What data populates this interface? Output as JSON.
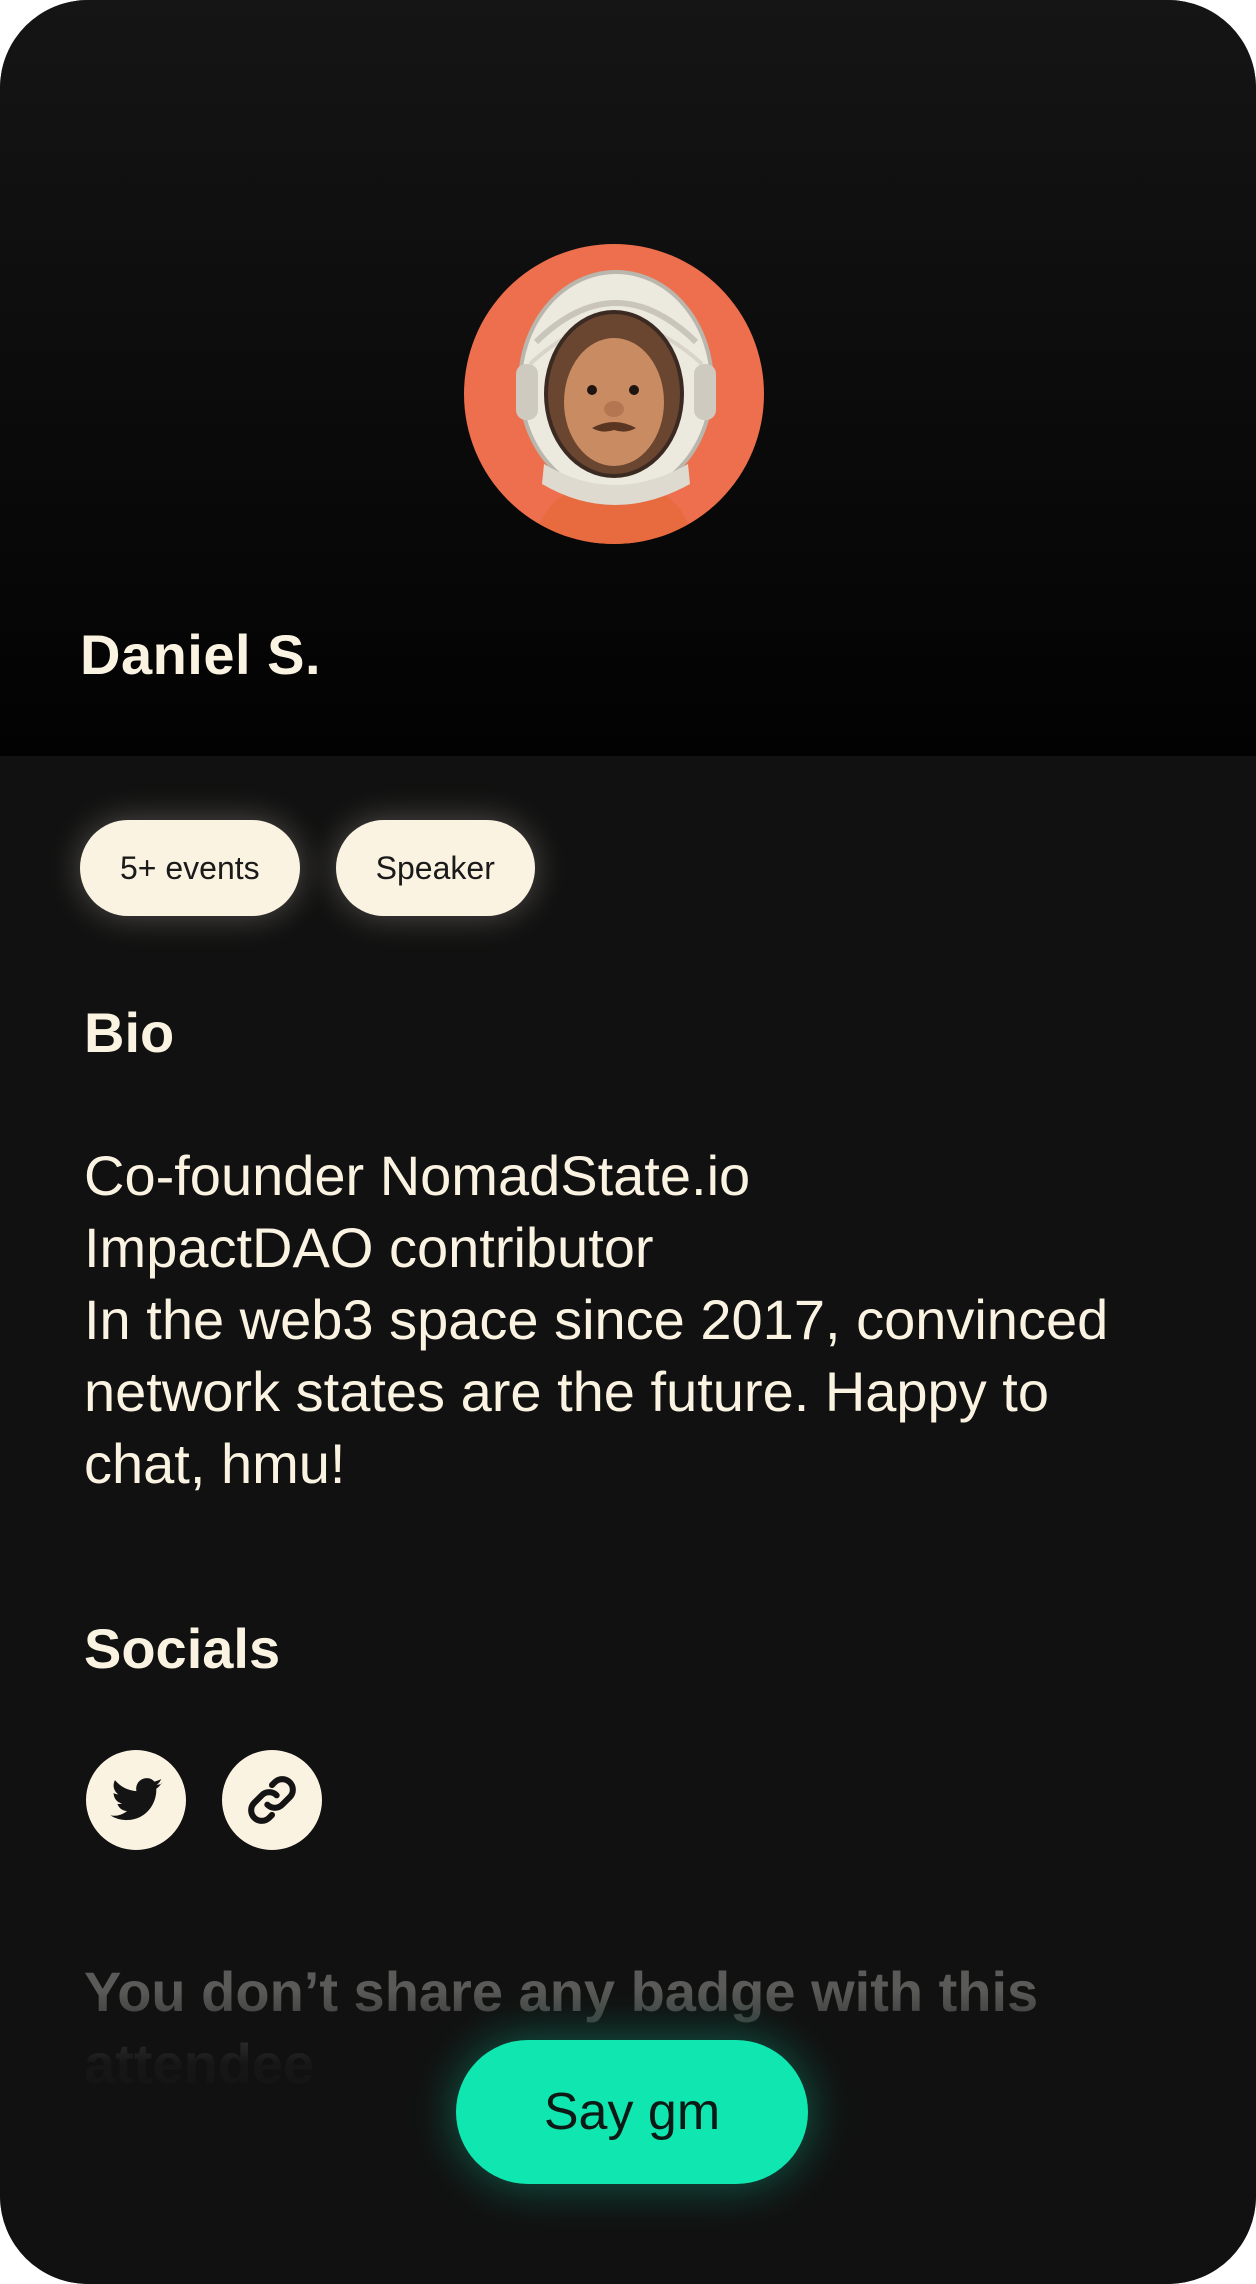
{
  "profile": {
    "name": "Daniel S.",
    "avatar_icon": "astronaut-avatar",
    "avatar_bg": "#ee6f4d"
  },
  "badges": [
    "5+ events",
    "Speaker"
  ],
  "bio": {
    "title": "Bio",
    "text": "Co-founder NomadState.io\nImpactDAO contributor\nIn the web3 space since 2017, convinced network states are the future. Happy to chat, hmu!"
  },
  "socials": {
    "title": "Socials",
    "items": [
      {
        "icon": "twitter-icon"
      },
      {
        "icon": "link-icon"
      }
    ]
  },
  "shared_badges_text": "You don’t share any badge with this attendee",
  "cta": {
    "label": "Say gm",
    "color": "#10e6b0"
  },
  "colors": {
    "background": "#111111",
    "text": "#fbf3e2",
    "muted": "#5a5a58"
  }
}
